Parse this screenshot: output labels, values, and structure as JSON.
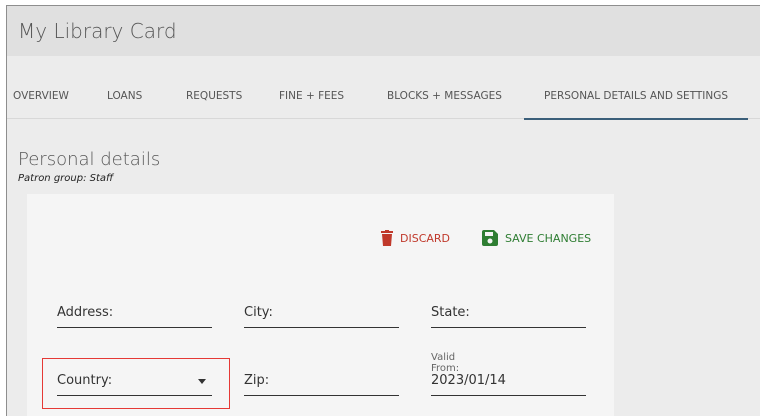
{
  "header": {
    "title": "My Library Card"
  },
  "tabs": [
    {
      "label": "OVERVIEW"
    },
    {
      "label": "LOANS"
    },
    {
      "label": "REQUESTS"
    },
    {
      "label": "FINE + FEES"
    },
    {
      "label": "BLOCKS + MESSAGES"
    },
    {
      "label": "PERSONAL DETAILS AND SETTINGS",
      "active": true
    }
  ],
  "section": {
    "title": "Personal details",
    "patron_group": "Patron group: Staff"
  },
  "actions": {
    "discard_label": "DISCARD",
    "save_label": "SAVE CHANGES",
    "discard_color": "#c0392b",
    "save_color": "#2e7d32"
  },
  "form": {
    "address_label": "Address:",
    "city_label": "City:",
    "state_label": "State:",
    "country_label": "Country:",
    "zip_label": "Zip:",
    "valid_from_label": "Valid From:",
    "valid_from_value": "2023/01/14"
  },
  "colors": {
    "active_tab_underline": "#3b5f7a",
    "highlight_border": "#e53935"
  }
}
